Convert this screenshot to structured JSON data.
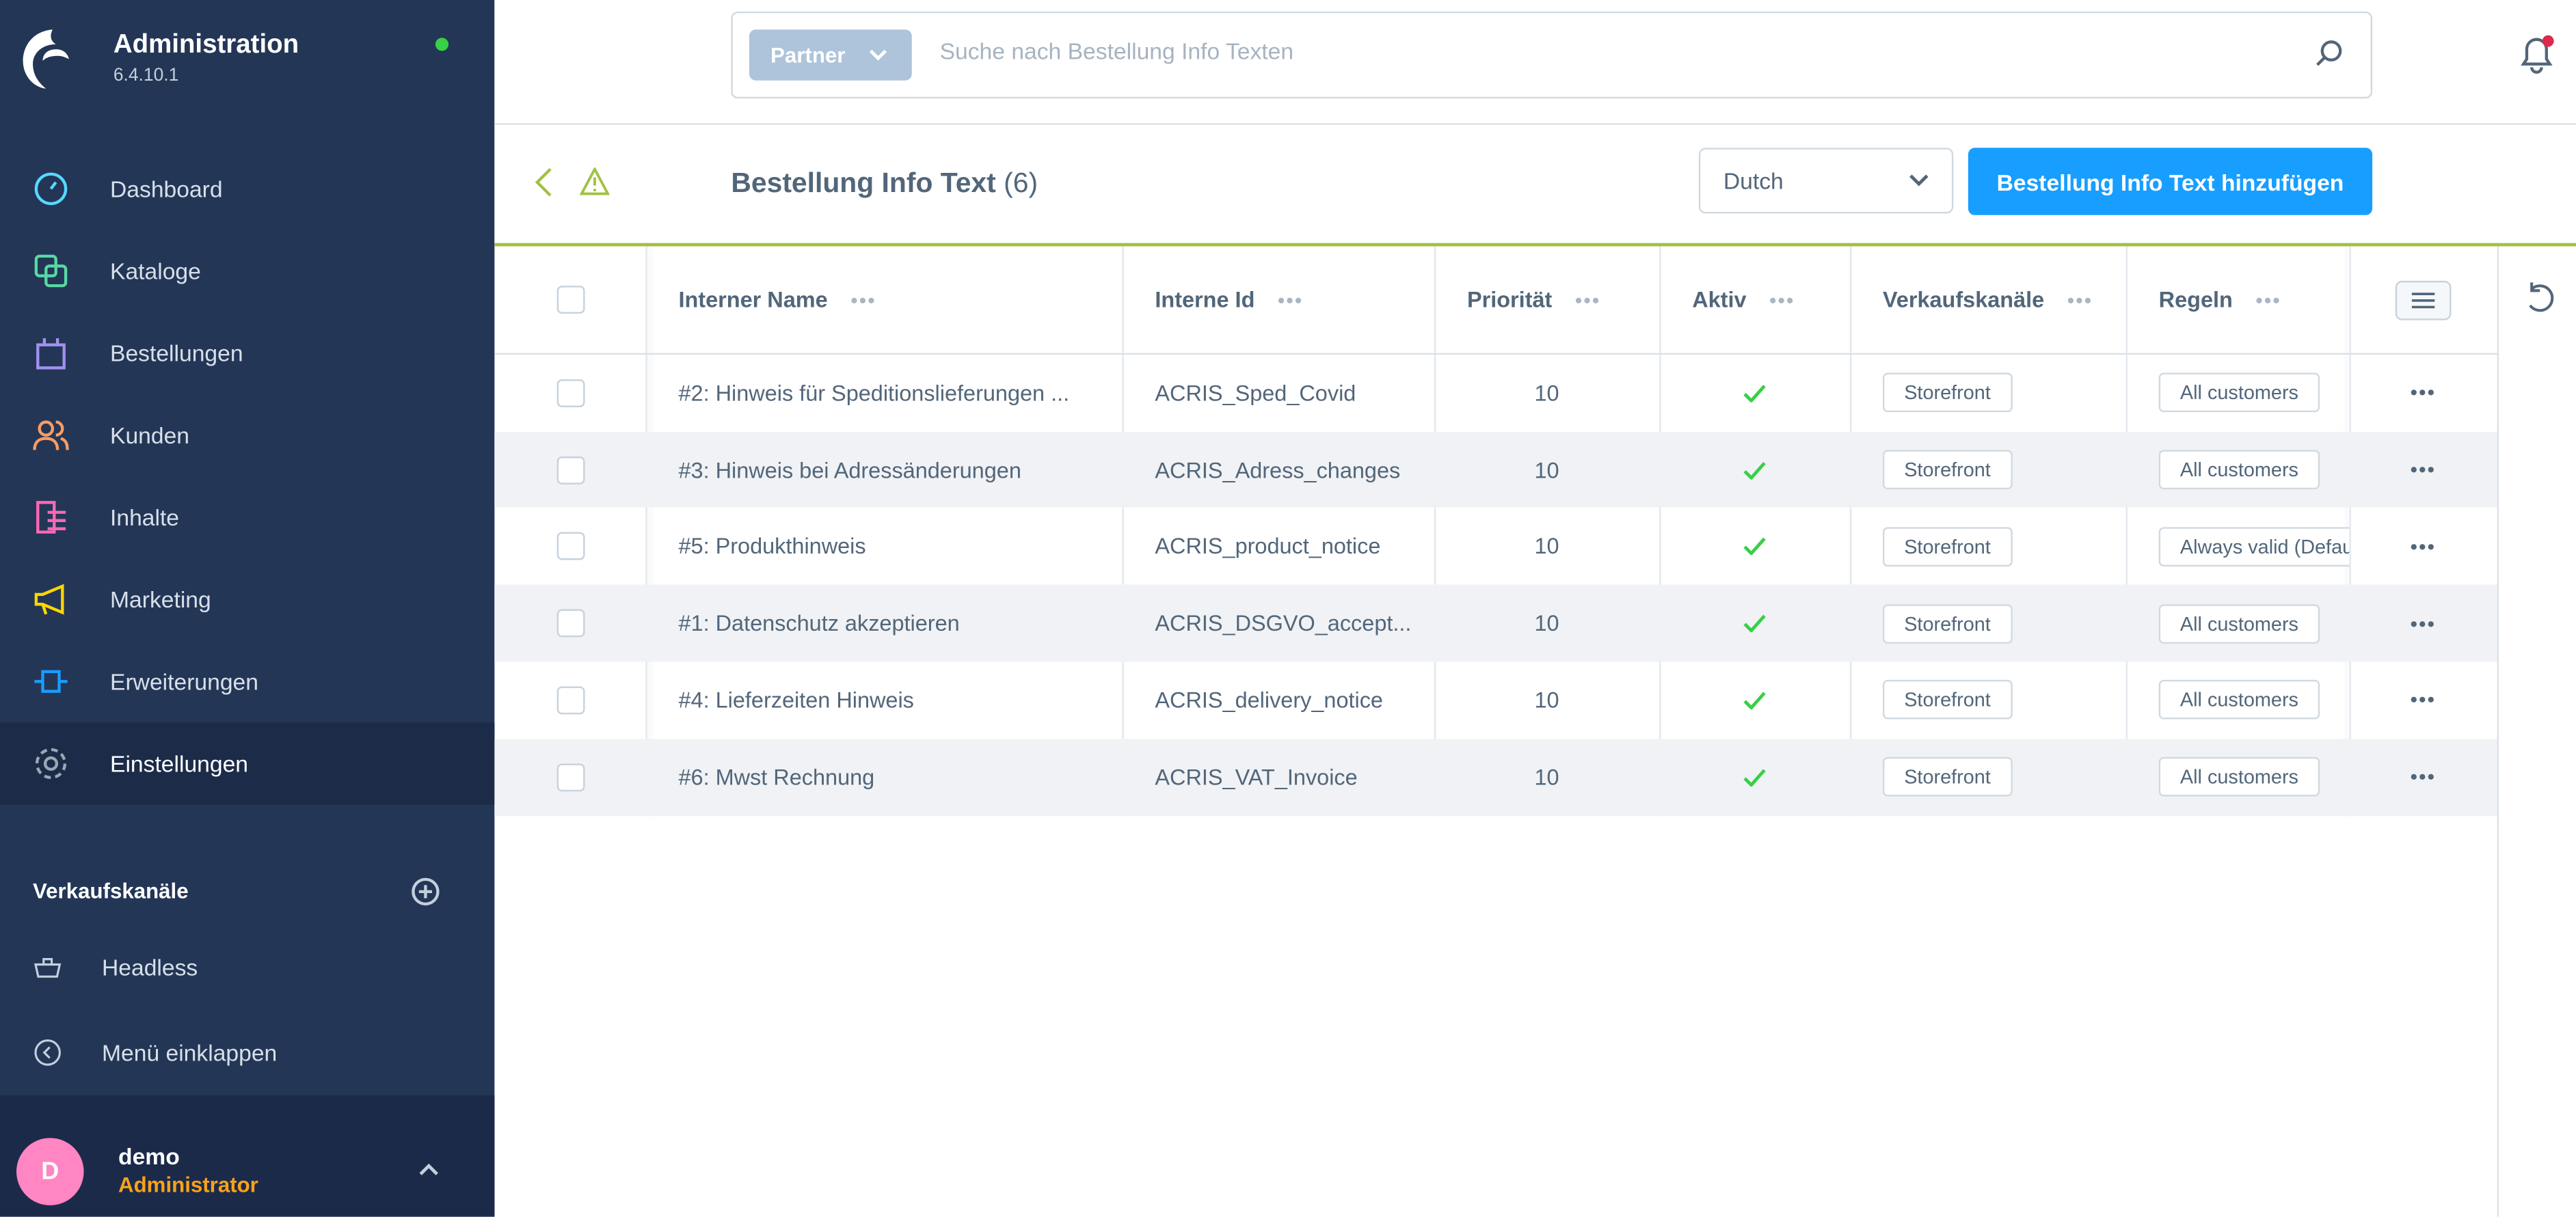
{
  "app": {
    "title": "Administration",
    "version": "6.4.10.1",
    "status_color": "#37d046"
  },
  "sidebar": {
    "items": [
      {
        "label": "Dashboard",
        "icon": "dashboard-icon",
        "color": "#57d9ff"
      },
      {
        "label": "Kataloge",
        "icon": "catalog-icon",
        "color": "#57d9a3"
      },
      {
        "label": "Bestellungen",
        "icon": "orders-icon",
        "color": "#a092f0"
      },
      {
        "label": "Kunden",
        "icon": "customers-icon",
        "color": "#ff9c62"
      },
      {
        "label": "Inhalte",
        "icon": "content-icon",
        "color": "#ff68b4"
      },
      {
        "label": "Marketing",
        "icon": "marketing-icon",
        "color": "#ffd700"
      },
      {
        "label": "Erweiterungen",
        "icon": "extensions-icon",
        "color": "#189eff"
      },
      {
        "label": "Einstellungen",
        "icon": "settings-icon",
        "color": "#9aa8b5",
        "active": true
      }
    ],
    "sales_channels_title": "Verkaufskanäle",
    "channels": [
      {
        "label": "Headless",
        "icon": "basket-icon"
      }
    ],
    "collapse_label": "Menü einklappen",
    "user": {
      "initial": "D",
      "name": "demo",
      "role": "Administrator"
    }
  },
  "search": {
    "scope": "Partner",
    "placeholder": "Suche nach Bestellung Info Texten"
  },
  "page": {
    "title": "Bestellung Info Text",
    "count": "(6)",
    "language": "Dutch",
    "add_label": "Bestellung Info Text hinzufügen"
  },
  "table": {
    "columns": [
      "Interner Name",
      "Interne Id",
      "Priorität",
      "Aktiv",
      "Verkaufskanäle",
      "Regeln"
    ],
    "rows": [
      {
        "name": "#2: Hinweis für Speditionslieferungen ...",
        "id": "ACRIS_Sped_Covid",
        "priority": "10",
        "active": true,
        "channel": "Storefront",
        "rule": "All customers"
      },
      {
        "name": "#3: Hinweis bei Adressänderungen",
        "id": "ACRIS_Adress_changes",
        "priority": "10",
        "active": true,
        "channel": "Storefront",
        "rule": "All customers"
      },
      {
        "name": "#5: Produkthinweis",
        "id": "ACRIS_product_notice",
        "priority": "10",
        "active": true,
        "channel": "Storefront",
        "rule": "Always valid (Default)"
      },
      {
        "name": "#1: Datenschutz akzeptieren",
        "id": "ACRIS_DSGVO_accept...",
        "priority": "10",
        "active": true,
        "channel": "Storefront",
        "rule": "All customers"
      },
      {
        "name": "#4: Lieferzeiten Hinweis",
        "id": "ACRIS_delivery_notice",
        "priority": "10",
        "active": true,
        "channel": "Storefront",
        "rule": "All customers"
      },
      {
        "name": "#6: Mwst Rechnung",
        "id": "ACRIS_VAT_Invoice",
        "priority": "10",
        "active": true,
        "channel": "Storefront",
        "rule": "All customers"
      }
    ]
  },
  "colors": {
    "accent": "#189eff",
    "sidebar": "#243656",
    "divider": "#a2c144",
    "check": "#37d046"
  }
}
